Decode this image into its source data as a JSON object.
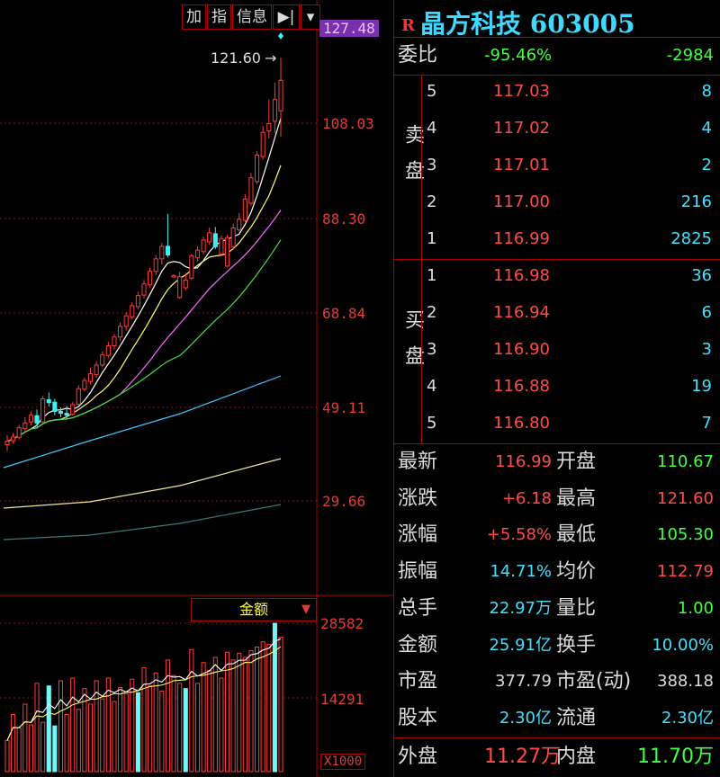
{
  "toolbar": {
    "add": "加",
    "index": "指",
    "info": "信息",
    "nav_icon": "skip-icon",
    "dropdown_icon": "chevron-down-icon"
  },
  "chart": {
    "price_axis": [
      "127.48",
      "108.03",
      "88.30",
      "68.84",
      "49.11",
      "29.66"
    ],
    "peak_label": "121.60",
    "volume_selector": "金额",
    "volume_axis": [
      "28582",
      "14291"
    ],
    "volume_unit": "X1000"
  },
  "chart_data": {
    "type": "candlestick",
    "price_ylim": [
      29.66,
      127.48
    ],
    "candles": [
      [
        41.5,
        42.2,
        40.2,
        43.5
      ],
      [
        42.3,
        43.1,
        41.8,
        44.0
      ],
      [
        43.0,
        45.0,
        42.6,
        45.6
      ],
      [
        44.8,
        46.0,
        44.0,
        47.2
      ],
      [
        46.2,
        47.6,
        45.5,
        48.4
      ],
      [
        47.5,
        46.0,
        45.2,
        48.8
      ],
      [
        46.2,
        51.0,
        45.8,
        51.6
      ],
      [
        50.8,
        50.2,
        49.4,
        52.3
      ],
      [
        50.3,
        48.4,
        47.6,
        51.0
      ],
      [
        48.4,
        48.0,
        47.2,
        49.2
      ],
      [
        48.0,
        47.6,
        46.9,
        49.5
      ],
      [
        47.8,
        49.8,
        47.5,
        50.3
      ],
      [
        49.9,
        53.1,
        49.6,
        53.8
      ],
      [
        53.0,
        54.8,
        52.5,
        55.4
      ],
      [
        54.6,
        56.2,
        54.0,
        57.4
      ],
      [
        56.0,
        58.0,
        55.4,
        58.8
      ],
      [
        58.0,
        60.1,
        57.5,
        60.8
      ],
      [
        60.0,
        62.0,
        59.4,
        62.8
      ],
      [
        62.0,
        63.8,
        61.2,
        64.4
      ],
      [
        63.8,
        66.0,
        63.0,
        66.8
      ],
      [
        66.0,
        68.2,
        65.2,
        69.0
      ],
      [
        68.0,
        70.3,
        67.5,
        71.0
      ],
      [
        70.1,
        72.4,
        69.5,
        73.2
      ],
      [
        72.5,
        74.8,
        71.8,
        75.6
      ],
      [
        74.6,
        77.4,
        73.9,
        78.2
      ],
      [
        77.4,
        80.0,
        76.6,
        80.8
      ],
      [
        80.0,
        82.6,
        78.8,
        83.3
      ],
      [
        82.6,
        80.8,
        80.3,
        89.3
      ],
      [
        76.5,
        76.5,
        76.2,
        76.8
      ],
      [
        72.0,
        76.3,
        71.7,
        77.3
      ],
      [
        74.0,
        75.6,
        73.5,
        77.1
      ],
      [
        76.0,
        80.6,
        75.6,
        81.0
      ],
      [
        80.2,
        81.8,
        79.5,
        82.6
      ],
      [
        81.5,
        83.9,
        81.0,
        84.6
      ],
      [
        83.5,
        85.4,
        82.9,
        86.5
      ],
      [
        85.2,
        82.5,
        82.0,
        86.6
      ],
      [
        81.0,
        84.2,
        80.5,
        84.8
      ],
      [
        78.5,
        84.4,
        78.3,
        85.0
      ],
      [
        82.5,
        86.4,
        82.0,
        87.3
      ],
      [
        86.0,
        88.2,
        85.5,
        89.5
      ],
      [
        88.0,
        92.4,
        87.6,
        93.4
      ],
      [
        91.5,
        96.8,
        91.0,
        97.8
      ],
      [
        96.0,
        101.5,
        95.5,
        102.3
      ],
      [
        101.2,
        106.2,
        100.6,
        107.5
      ],
      [
        106.5,
        108.0,
        105.0,
        113.0
      ],
      [
        108.5,
        113.0,
        106.0,
        116.5
      ],
      [
        110.67,
        116.99,
        105.3,
        121.6
      ]
    ],
    "volume_ylim": [
      0,
      28582
    ],
    "volumes": [
      6000,
      11000,
      8400,
      13000,
      9000,
      17000,
      9500,
      16500,
      8800,
      17500,
      11000,
      18000,
      12000,
      16000,
      13000,
      17500,
      14000,
      18000,
      13500,
      16200,
      15000,
      17800,
      15200,
      20000,
      16500,
      19000,
      15500,
      21500,
      18500,
      17000,
      16000,
      23500,
      17000,
      21000,
      19500,
      22000,
      18000,
      23000,
      21500,
      22800,
      22000,
      23300,
      24000,
      25000,
      24500,
      28582,
      25910
    ],
    "volume_highlights": [
      7,
      8,
      22,
      30,
      45
    ]
  },
  "quote": {
    "name": "晶方科技",
    "code": "603005",
    "r_mark": "R",
    "webi_label": "委比",
    "webi_value": "-95.46%",
    "webi_diff": "-2984",
    "sell_label": "卖盘",
    "buy_label": "买盘",
    "sell": [
      {
        "lvl": "5",
        "price": "117.03",
        "qty": "8"
      },
      {
        "lvl": "4",
        "price": "117.02",
        "qty": "4"
      },
      {
        "lvl": "3",
        "price": "117.01",
        "qty": "2"
      },
      {
        "lvl": "2",
        "price": "117.00",
        "qty": "216"
      },
      {
        "lvl": "1",
        "price": "116.99",
        "qty": "2825"
      }
    ],
    "buy": [
      {
        "lvl": "1",
        "price": "116.98",
        "qty": "36"
      },
      {
        "lvl": "2",
        "price": "116.94",
        "qty": "6"
      },
      {
        "lvl": "3",
        "price": "116.90",
        "qty": "3"
      },
      {
        "lvl": "4",
        "price": "116.88",
        "qty": "19"
      },
      {
        "lvl": "5",
        "price": "116.80",
        "qty": "7"
      }
    ],
    "stats": [
      {
        "l1": "最新",
        "v1": "116.99",
        "c1": "red",
        "l2": "开盘",
        "v2": "110.67",
        "c2": "green"
      },
      {
        "l1": "涨跌",
        "v1": "+6.18",
        "c1": "red",
        "l2": "最高",
        "v2": "121.60",
        "c2": "red"
      },
      {
        "l1": "涨幅",
        "v1": "+5.58%",
        "c1": "red",
        "l2": "最低",
        "v2": "105.30",
        "c2": "green"
      },
      {
        "l1": "振幅",
        "v1": "14.71%",
        "c1": "cyan",
        "l2": "均价",
        "v2": "112.79",
        "c2": "red"
      },
      {
        "l1": "总手",
        "v1": "22.97万",
        "c1": "cyan",
        "l2": "量比",
        "v2": "1.00",
        "c2": "green"
      },
      {
        "l1": "金额",
        "v1": "25.91亿",
        "c1": "cyan",
        "l2": "换手",
        "v2": "10.00%",
        "c2": "cyan"
      },
      {
        "l1": "市盈",
        "v1": "377.79",
        "c1": "white",
        "l2": "市盈(动)",
        "v2": "388.18",
        "c2": "white"
      },
      {
        "l1": "股本",
        "v1": "2.30亿",
        "c1": "cyan",
        "l2": "流通",
        "v2": "2.30亿",
        "c2": "cyan"
      }
    ],
    "outer_label": "外盘",
    "outer_value": "11.27万",
    "inner_label": "内盘",
    "inner_value": "11.70万"
  }
}
